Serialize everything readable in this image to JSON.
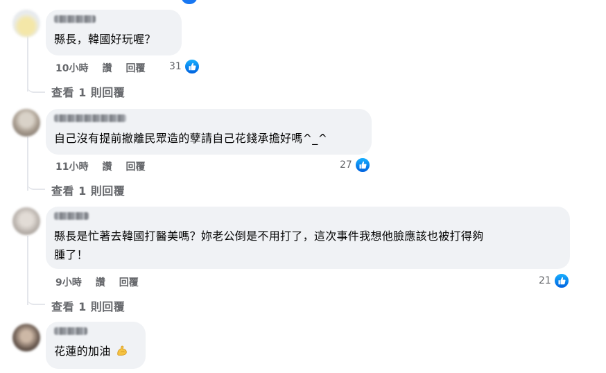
{
  "comments": [
    {
      "text": "縣長，韓國好玩喔？",
      "time": "10小時",
      "like_label": "讚",
      "reply_label": "回覆",
      "likes": "31",
      "view_replies": "查看 1 則回覆"
    },
    {
      "text": "自己沒有提前撤離民眾造的孽請自己花錢承擔好嗎^_^",
      "time": "11小時",
      "like_label": "讚",
      "reply_label": "回覆",
      "likes": "27",
      "view_replies": "查看 1 則回覆"
    },
    {
      "text_line1": "縣長是忙著去韓國打醫美嗎？妳老公倒是不用打了，這次事件我想他臉應該也被打得夠",
      "text_line2": "腫了！",
      "time": "9小時",
      "like_label": "讚",
      "reply_label": "回覆",
      "likes": "21",
      "view_replies": "查看 1 則回覆"
    },
    {
      "text": "花蓮的加油"
    }
  ],
  "icons": {
    "like": "thumbs-up-icon",
    "emoji": "flexed-biceps-icon"
  },
  "colors": {
    "bubble": "#f0f2f5",
    "meta": "#65676b",
    "like_blue": "#1877f2"
  }
}
